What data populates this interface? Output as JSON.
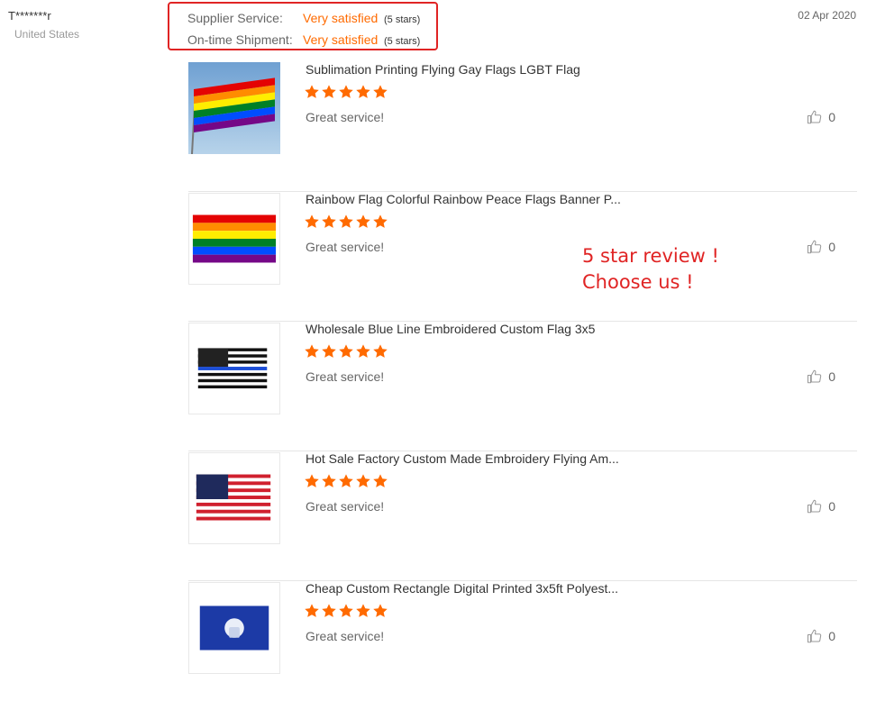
{
  "reviewer": {
    "name": "T*******r",
    "country": "United States"
  },
  "date": "02 Apr 2020",
  "ratings": [
    {
      "label": "Supplier Service:",
      "value": "Very satisfied",
      "stars": "(5 stars)"
    },
    {
      "label": "On-time Shipment:",
      "value": "Very satisfied",
      "stars": "(5 stars)"
    }
  ],
  "products": [
    {
      "title": "Sublimation Printing Flying Gay Flags LGBT Flag",
      "rating": 5,
      "review": "Great service!",
      "likes": "0",
      "flag": "rainbow-flying"
    },
    {
      "title": "Rainbow Flag Colorful Rainbow Peace Flags Banner P...",
      "rating": 5,
      "review": "Great service!",
      "likes": "0",
      "flag": "rainbow"
    },
    {
      "title": "Wholesale Blue Line Embroidered Custom Flag 3x5",
      "rating": 5,
      "review": "Great service!",
      "likes": "0",
      "flag": "blue-line"
    },
    {
      "title": "Hot Sale Factory Custom Made Embroidery Flying Am...",
      "rating": 5,
      "review": "Great service!",
      "likes": "0",
      "flag": "us"
    },
    {
      "title": "Cheap Custom Rectangle Digital Printed 3x5ft Polyest...",
      "rating": 5,
      "review": "Great service!",
      "likes": "0",
      "flag": "air-force"
    }
  ],
  "promo": {
    "line1": "5 star review !",
    "line2": "Choose us !"
  },
  "colors": {
    "star": "#ff6a00",
    "highlight_border": "#e02424",
    "promo_text": "#e02424"
  },
  "icons": {
    "star": "star-icon",
    "like": "thumbs-up-icon"
  }
}
